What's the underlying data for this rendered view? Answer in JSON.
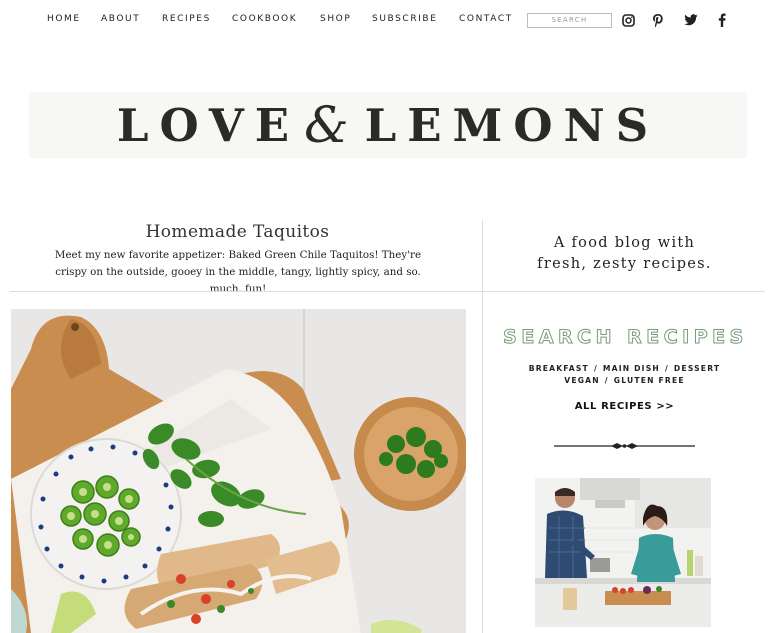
{
  "nav": {
    "items": [
      {
        "label": "HOME"
      },
      {
        "label": "ABOUT"
      },
      {
        "label": "RECIPES"
      },
      {
        "label": "COOKBOOK"
      },
      {
        "label": "SHOP"
      },
      {
        "label": "SUBSCRIBE"
      },
      {
        "label": "CONTACT"
      }
    ],
    "search_placeholder": "SEARCH",
    "social": [
      "instagram-icon",
      "pinterest-icon",
      "twitter-icon",
      "facebook-icon"
    ]
  },
  "logo": {
    "left": "LOVE",
    "amp": "&",
    "right": "LEMONS"
  },
  "post": {
    "title": "Homemade Taquitos",
    "excerpt": "Meet my new favorite appetizer: Baked Green Chile Taquitos! They're crispy on the outside, gooey in the middle, tangy, lightly spicy, and so. much. fun!"
  },
  "sidebar": {
    "tagline_line1": "A food blog with",
    "tagline_line2": "fresh, zesty recipes.",
    "search_heading": "SEARCH RECIPES",
    "categories_row1": [
      "BREAKFAST",
      "MAIN DISH",
      "DESSERT"
    ],
    "categories_row2": [
      "VEGAN",
      "GLUTEN FREE"
    ],
    "separator": "/",
    "all_recipes": "ALL RECIPES >>"
  },
  "colors": {
    "text": "#222222",
    "rule": "#dddddd",
    "search_heading_outline": "#7a9a7a",
    "logo_band": "#f7f7f6"
  }
}
